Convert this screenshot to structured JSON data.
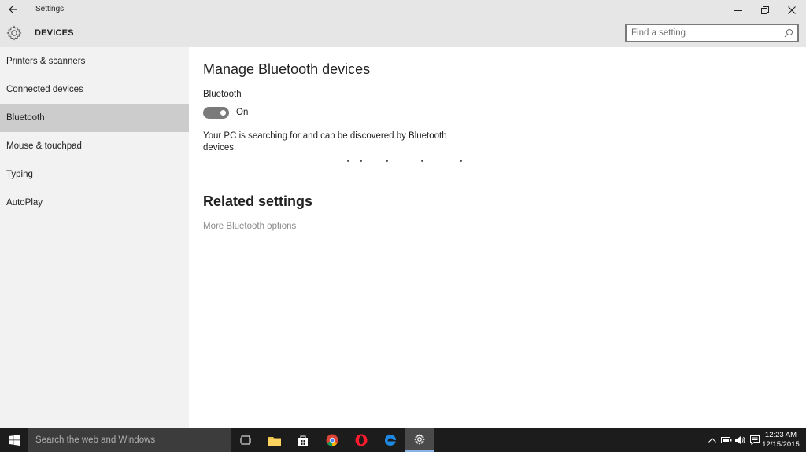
{
  "titlebar": {
    "title": "Settings"
  },
  "header": {
    "section": "DEVICES",
    "search_placeholder": "Find a setting"
  },
  "sidebar": {
    "items": [
      {
        "label": "Printers & scanners"
      },
      {
        "label": "Connected devices"
      },
      {
        "label": "Bluetooth",
        "selected": true
      },
      {
        "label": "Mouse & touchpad"
      },
      {
        "label": "Typing"
      },
      {
        "label": "AutoPlay"
      }
    ]
  },
  "main": {
    "heading": "Manage Bluetooth devices",
    "bluetooth_label": "Bluetooth",
    "toggle_state": "On",
    "description": "Your PC is searching for and can be discovered by Bluetooth devices.",
    "related_heading": "Related settings",
    "related_link": "More Bluetooth options"
  },
  "taskbar": {
    "search_placeholder": "Search the web and Windows",
    "apps": [
      "task-view",
      "file-explorer",
      "store",
      "chrome",
      "opera",
      "edge",
      "settings"
    ],
    "time": "12:23 AM",
    "date": "12/15/2015"
  },
  "colors": {
    "accent": "#7a7a7a",
    "selected": "#cccccc",
    "sidebar_bg": "#f2f2f2",
    "taskbar": "#1c1c1c"
  }
}
